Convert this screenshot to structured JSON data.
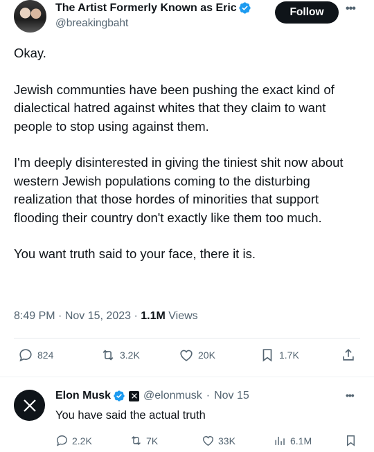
{
  "author": {
    "display_name": "The Artist Formerly Known as Eric",
    "handle": "@breakingbaht",
    "verified_badge": "verified-badge-icon",
    "follow_label": "Follow"
  },
  "tweet": {
    "paragraphs": [
      "Okay.",
      "Jewish communties have been pushing the exact kind of dialectical hatred against whites that they claim to want people to stop using against them.",
      "I'm deeply disinterested in giving the tiniest shit now about western Jewish populations coming to the disturbing realization that those hordes of minorities that support flooding their country don't exactly like them too much.",
      "You want truth said to your face, there it is."
    ],
    "time": "8:49 PM",
    "dot1": "·",
    "date": "Nov 15, 2023",
    "dot2": "·",
    "views_count": "1.1M",
    "views_label": "Views"
  },
  "actions": {
    "replies": "824",
    "reposts": "3.2K",
    "likes": "20K",
    "bookmarks": "1.7K"
  },
  "reply": {
    "name": "Elon Musk",
    "handle": "@elonmusk",
    "dot": "·",
    "date": "Nov 15",
    "text": "You have said the actual truth",
    "replies": "2.2K",
    "reposts": "7K",
    "likes": "33K",
    "views": "6.1M"
  },
  "colors": {
    "accent": "#1d9bf0",
    "text_primary": "#0f1419",
    "text_secondary": "#536471"
  }
}
